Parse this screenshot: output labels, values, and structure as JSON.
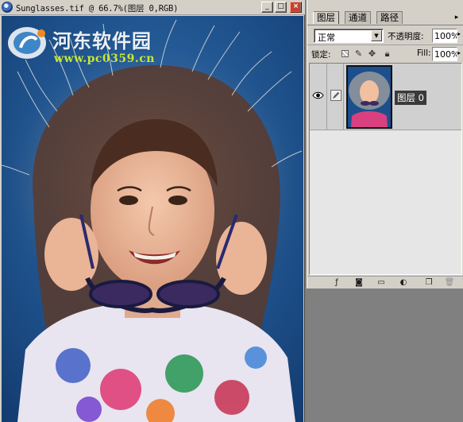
{
  "document": {
    "title": "Sunglasses.tif @ 66.7%(图层 0,RGB)",
    "window_buttons": {
      "minimize": "_",
      "maximize": "□",
      "close": "×"
    }
  },
  "watermark": {
    "name": "河东软件园",
    "url": "www.pc0359.cn"
  },
  "layers_palette": {
    "tabs": [
      {
        "label": "图层",
        "active": true
      },
      {
        "label": "通道",
        "active": false
      },
      {
        "label": "路径",
        "active": false
      }
    ],
    "menu_arrow": "▸",
    "blend_mode": "正常",
    "opacity_label": "不透明度:",
    "opacity_value": "100%",
    "lock_label": "锁定:",
    "fill_label": "Fill:",
    "fill_value": "100%",
    "layers": [
      {
        "name": "图层 0",
        "visible": true,
        "selected": true
      }
    ],
    "footer_icons": [
      "fx-icon",
      "mask-icon",
      "folder-icon",
      "adjustment-icon",
      "new-layer-icon",
      "trash-icon"
    ]
  },
  "colors": {
    "chrome": "#d4d0c8",
    "photo_background": "#1c4f8c",
    "workspace": "#808080",
    "selected_layer_label": "#3a3a3a",
    "watermark_url": "#c8e632"
  }
}
